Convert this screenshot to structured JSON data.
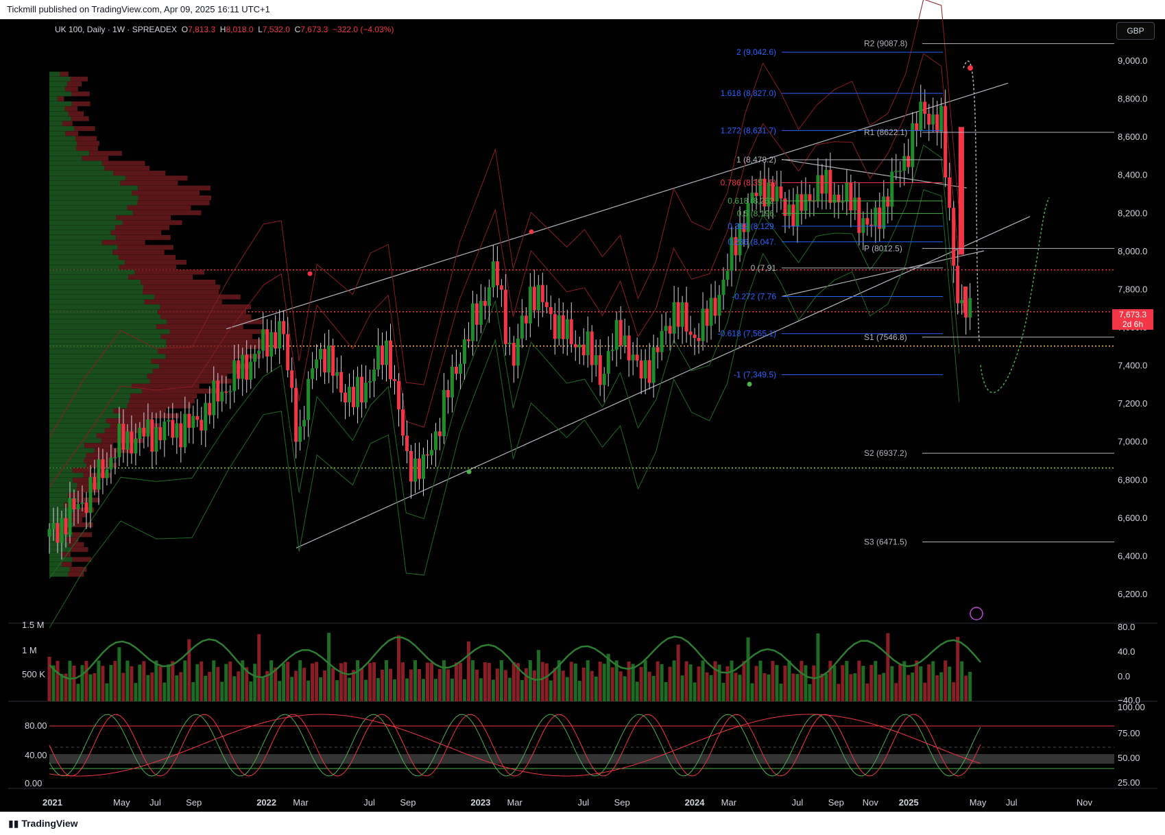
{
  "header": {
    "publisher": "Tickmill published on TradingView.com, Apr 09, 2025 16:11 UTC+1"
  },
  "footer": {
    "brand": "TradingView"
  },
  "legend": {
    "symbol": "UK 100, Daily · 1W · SPREADEX",
    "o_label": "O",
    "o": "7,813.3",
    "h_label": "H",
    "h": "8,018.0",
    "l_label": "L",
    "l": "7,532.0",
    "c_label": "C",
    "c": "7,673.3",
    "change": "−322.0 (−4.03%)"
  },
  "currency_button": "GBP",
  "last_price": {
    "value": "7,673.3",
    "countdown": "2d 6h"
  },
  "colors": {
    "up": "#1e8c2a",
    "down": "#f23645",
    "fib_blue": "#2962ff",
    "white_line": "#b2b5be",
    "bg": "#000000"
  },
  "chart_data": [
    {
      "type": "candlestick",
      "title": "UK 100, Daily · 1W · SPREADEX",
      "ylim": [
        6000,
        9300
      ],
      "y_ticks": [
        "9,000.0",
        "8,800.0",
        "8,600.0",
        "8,400.0",
        "8,200.0",
        "8,000.0",
        "7,800.0",
        "7,600.0",
        "7,400.0",
        "7,200.0",
        "7,000.0",
        "6,800.0",
        "6,600.0",
        "6,400.0",
        "6,200.0"
      ],
      "x_ticks": [
        "2021",
        "May",
        "Jul",
        "Sep",
        "2022",
        "Mar",
        "Jul",
        "Sep",
        "2023",
        "Mar",
        "Jul",
        "Sep",
        "2024",
        "Mar",
        "Jul",
        "Sep",
        "Nov",
        "2025",
        "May",
        "Jul",
        "Nov"
      ],
      "close_path": [
        [
          "2021-01",
          6500
        ],
        [
          "2021-03",
          6700
        ],
        [
          "2021-05",
          7000
        ],
        [
          "2021-07",
          7050
        ],
        [
          "2021-09",
          7080
        ],
        [
          "2021-11",
          7300
        ],
        [
          "2022-01",
          7500
        ],
        [
          "2022-02",
          7600
        ],
        [
          "2022-03",
          7000
        ],
        [
          "2022-04",
          7500
        ],
        [
          "2022-06",
          7200
        ],
        [
          "2022-07",
          7350
        ],
        [
          "2022-08",
          7500
        ],
        [
          "2022-09",
          6900
        ],
        [
          "2022-10",
          6850
        ],
        [
          "2022-12",
          7450
        ],
        [
          "2023-02",
          7900
        ],
        [
          "2023-03",
          7400
        ],
        [
          "2023-04",
          7800
        ],
        [
          "2023-06",
          7550
        ],
        [
          "2023-07",
          7500
        ],
        [
          "2023-08",
          7350
        ],
        [
          "2023-09",
          7600
        ],
        [
          "2023-10",
          7350
        ],
        [
          "2023-11",
          7450
        ],
        [
          "2023-12",
          7700
        ],
        [
          "2024-01",
          7550
        ],
        [
          "2024-02",
          7650
        ],
        [
          "2024-03",
          7900
        ],
        [
          "2024-04",
          8200
        ],
        [
          "2024-05",
          8350
        ],
        [
          "2024-06",
          8250
        ],
        [
          "2024-07",
          8200
        ],
        [
          "2024-08",
          8350
        ],
        [
          "2024-09",
          8300
        ],
        [
          "2024-10",
          8250
        ],
        [
          "2024-11",
          8100
        ],
        [
          "2024-12",
          8300
        ],
        [
          "2025-01",
          8500
        ],
        [
          "2025-02",
          8750
        ],
        [
          "2025-03",
          8650
        ],
        [
          "2025-04",
          7673.3
        ]
      ],
      "fib_levels": [
        {
          "label": "2 (9,042.6)",
          "value": 9042.6
        },
        {
          "label": "1.618 (8,827.0)",
          "value": 8827.0
        },
        {
          "label": "1.272 (8,631.7)",
          "value": 8631.7
        },
        {
          "label": "1 (8,478.2)",
          "value": 8478.2
        },
        {
          "label": "0.786 (8,357.5)",
          "value": 8357.5
        },
        {
          "label": "0.618 (8,262.",
          "value": 8262
        },
        {
          "label": "0.5 (8,196.",
          "value": 8196
        },
        {
          "label": "0.382 (8,129.",
          "value": 8129
        },
        {
          "label": "0.236 (8,047.",
          "value": 8047
        },
        {
          "label": "0 (7,91",
          "value": 7910
        },
        {
          "label": "-0.272 (7,76",
          "value": 7760
        },
        {
          "label": "-0.618 (7,565.1)",
          "value": 7565.1
        },
        {
          "label": "-1 (7,349.5)",
          "value": 7349.5
        }
      ],
      "pivot_levels": [
        {
          "label": "R2 (9087.8)",
          "value": 9087.8
        },
        {
          "label": "R1 (8622.1)",
          "value": 8622.1
        },
        {
          "label": "P (8012.5)",
          "value": 8012.5
        },
        {
          "label": "S1 (7546.8)",
          "value": 7546.8
        },
        {
          "label": "S2 (6937.2)",
          "value": 6937.2
        },
        {
          "label": "S3 (6471.5)",
          "value": 6471.5
        }
      ],
      "horizontal_dotted_levels": [
        {
          "value": 7900,
          "color": "#f23645"
        },
        {
          "value": 7680,
          "color": "#f23645"
        },
        {
          "value": 7500,
          "color": "#ffb74d"
        },
        {
          "value": 6860,
          "color": "#9acd32"
        }
      ]
    },
    {
      "type": "bar",
      "title": "Volume",
      "y_ticks_left": [
        "1.5 M",
        "1 M",
        "500 K"
      ],
      "y_ticks_right": [
        "80.0",
        "40.0",
        "0.0",
        "−40.0"
      ]
    },
    {
      "type": "line",
      "title": "Stochastic RSI",
      "y_ticks_left": [
        "80.00",
        "40.00",
        "0.00"
      ],
      "y_ticks_right": [
        "100.00",
        "75.00",
        "50.00",
        "25.00"
      ]
    }
  ]
}
